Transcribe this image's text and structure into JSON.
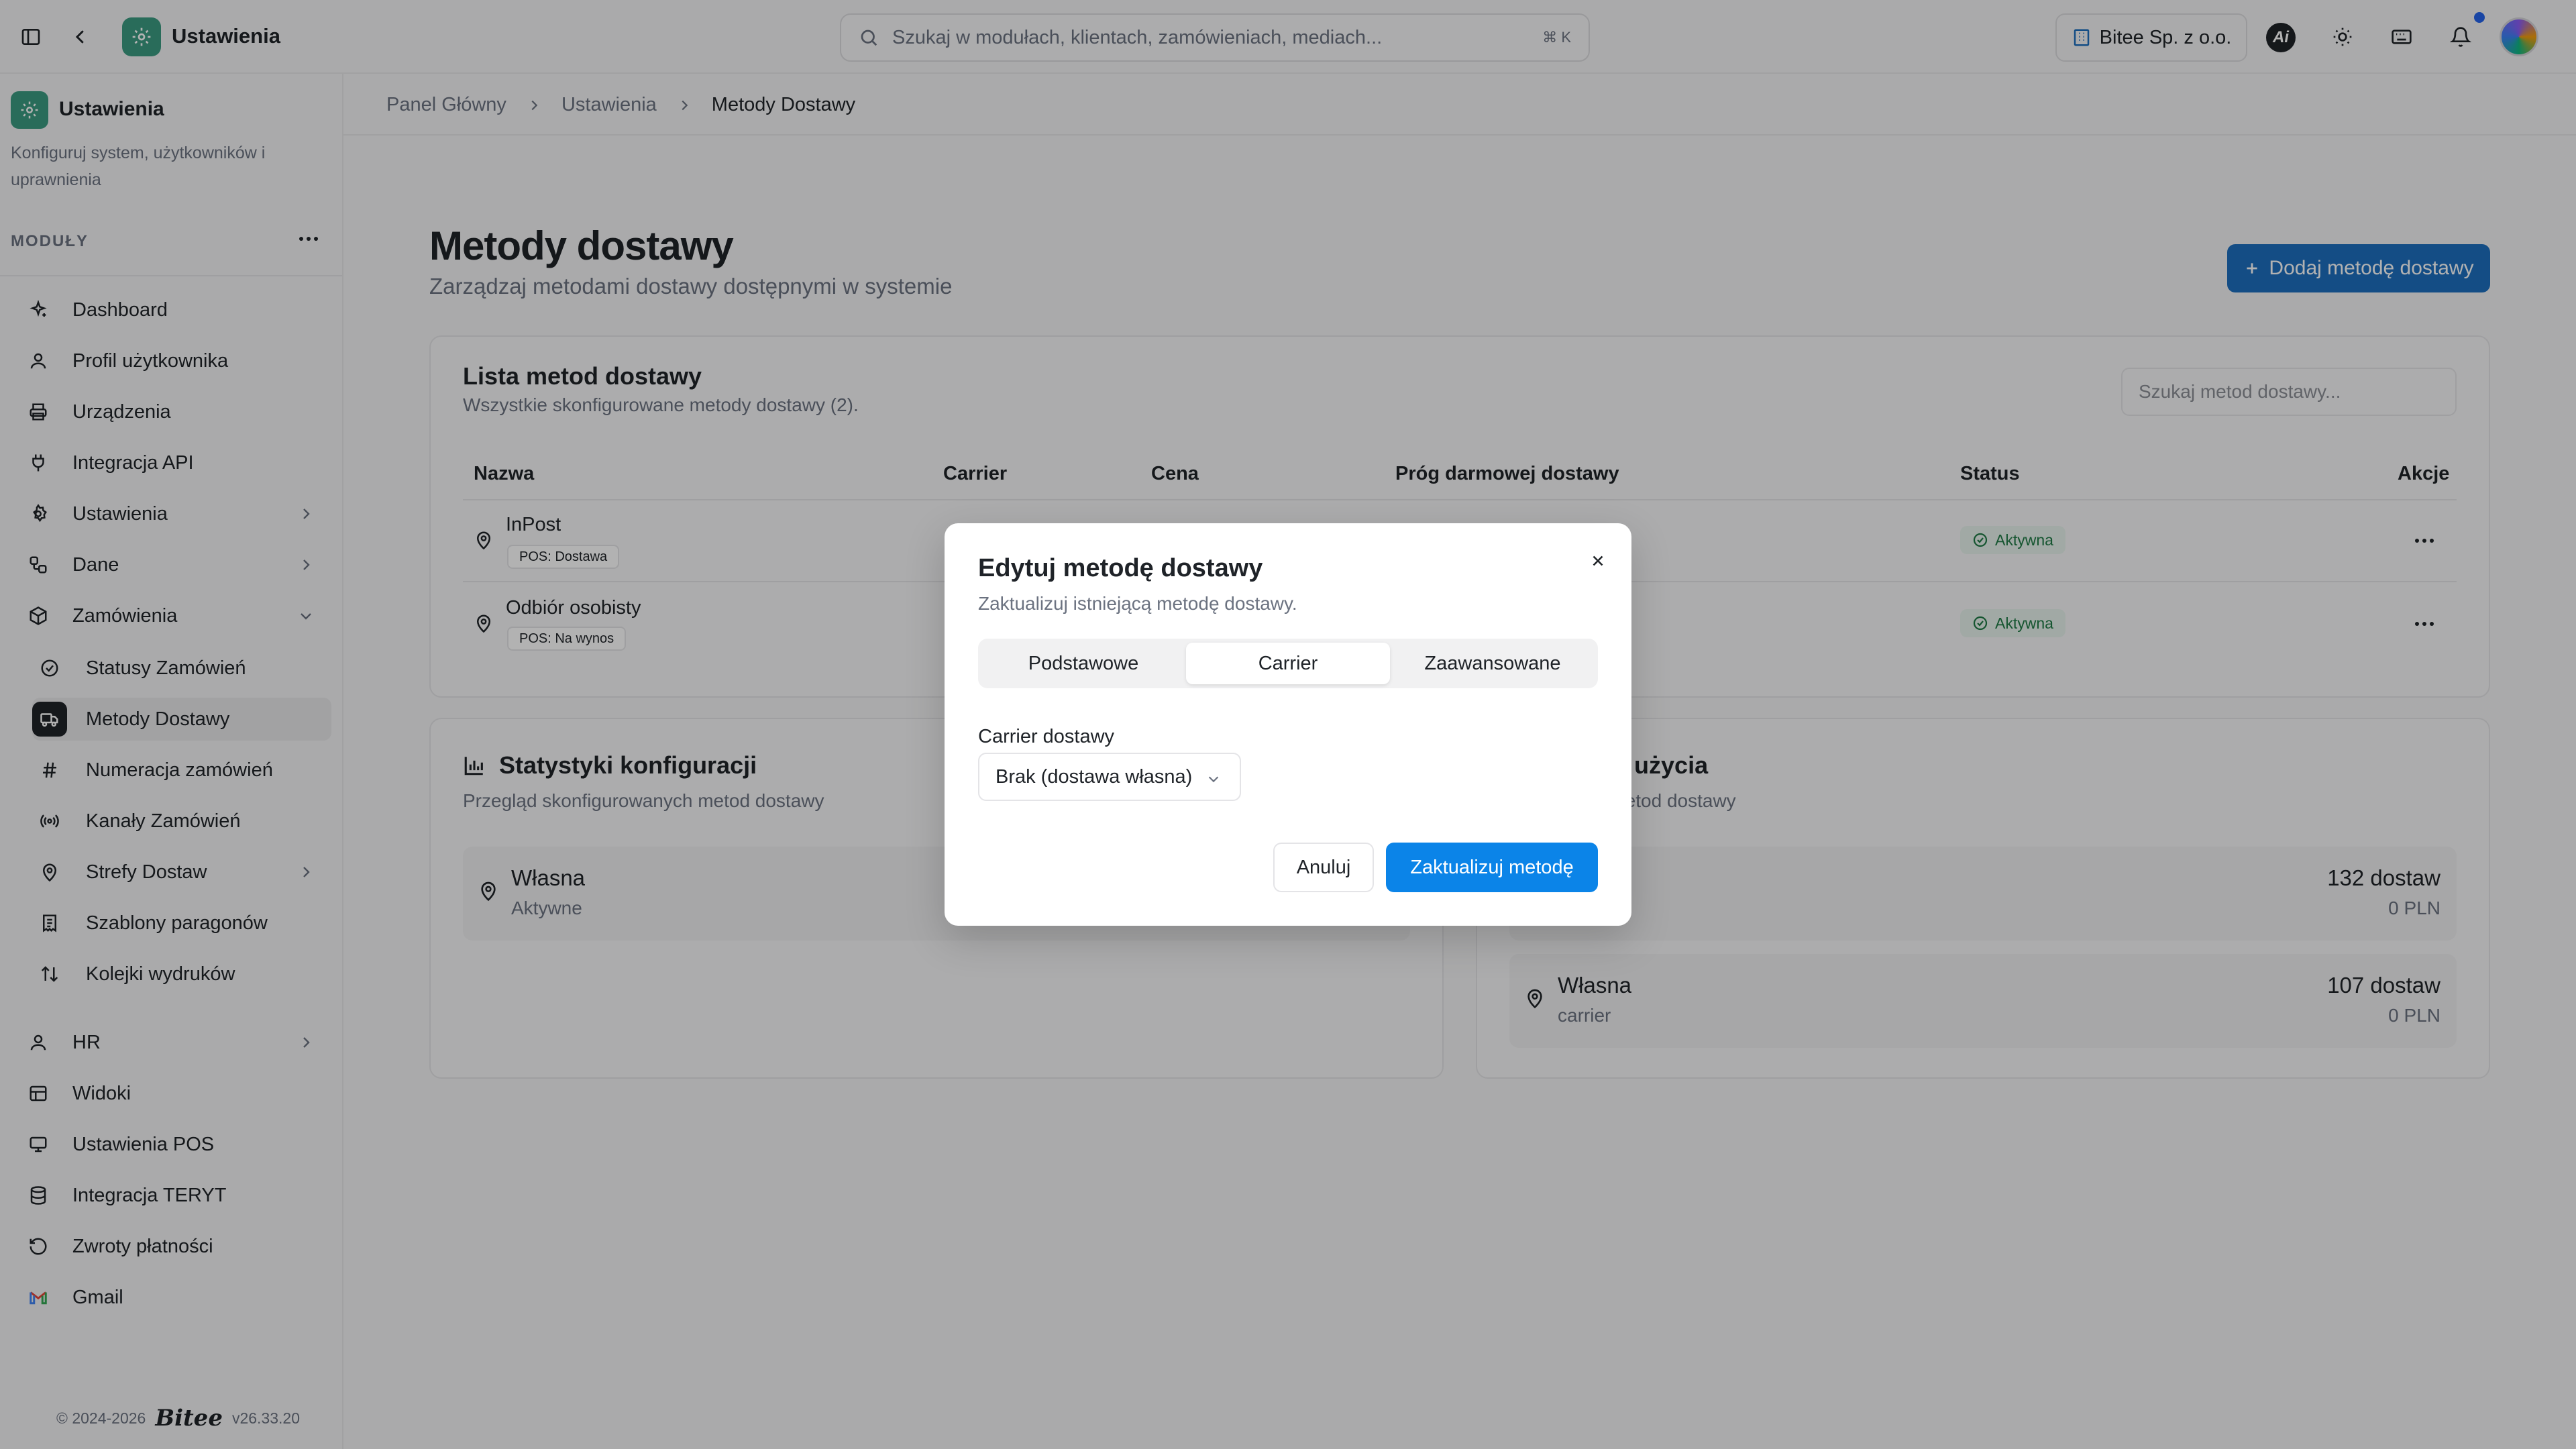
{
  "topbar": {
    "app_title": "Ustawienia",
    "search_placeholder": "Szukaj w modułach, klientach, zamówieniach, mediach...",
    "search_shortcut": "⌘ K",
    "company": "Bitee Sp. z o.o.",
    "ai_label": "Ai"
  },
  "sidebar": {
    "title": "Ustawienia",
    "description": "Konfiguruj system, użytkowników i uprawnienia",
    "modules_label": "MODUŁY",
    "items": [
      {
        "label": "Dashboard",
        "icon": "sparkles-icon"
      },
      {
        "label": "Profil użytkownika",
        "icon": "user-icon"
      },
      {
        "label": "Urządzenia",
        "icon": "printer-icon"
      },
      {
        "label": "Integracja API",
        "icon": "plug-icon"
      },
      {
        "label": "Ustawienia",
        "icon": "gear-icon"
      },
      {
        "label": "Dane",
        "icon": "data-icon"
      },
      {
        "label": "Zamówienia",
        "icon": "package-icon"
      }
    ],
    "sub_items": [
      {
        "label": "Statusy Zamówień",
        "icon": "circle-check-icon"
      },
      {
        "label": "Metody Dostawy",
        "icon": "truck-icon"
      },
      {
        "label": "Numeracja zamówień",
        "icon": "hash-icon"
      },
      {
        "label": "Kanały Zamówień",
        "icon": "radio-icon"
      },
      {
        "label": "Strefy Dostaw",
        "icon": "map-pin-icon"
      },
      {
        "label": "Szablony paragonów",
        "icon": "receipt-icon"
      },
      {
        "label": "Kolejki wydruków",
        "icon": "sort-icon"
      }
    ],
    "bottom_items": [
      {
        "label": "HR",
        "icon": "user-icon"
      },
      {
        "label": "Widoki",
        "icon": "table-icon"
      },
      {
        "label": "Ustawienia POS",
        "icon": "monitor-icon"
      },
      {
        "label": "Integracja TERYT",
        "icon": "database-icon"
      },
      {
        "label": "Zwroty płatności",
        "icon": "rotate-icon"
      },
      {
        "label": "Gmail",
        "icon": "gmail-icon"
      }
    ],
    "footer": {
      "copyright": "© 2024-2026",
      "brand": "Bitee",
      "version": "v26.33.20"
    }
  },
  "breadcrumb": [
    "Panel Główny",
    "Ustawienia",
    "Metody Dostawy"
  ],
  "page": {
    "title": "Metody dostawy",
    "subtitle": "Zarządzaj metodami dostawy dostępnymi w systemie",
    "add_button": "Dodaj metodę dostawy"
  },
  "list": {
    "title": "Lista metod dostawy",
    "subtitle": "Wszystkie skonfigurowane metody dostawy (2).",
    "search_placeholder": "Szukaj metod dostawy...",
    "columns": [
      "Nazwa",
      "Carrier",
      "Cena",
      "Próg darmowej dostawy",
      "Status",
      "Akcje"
    ],
    "rows": [
      {
        "name": "InPost",
        "badge": "POS: Dostawa",
        "status": "Aktywna"
      },
      {
        "name": "Odbiór osobisty",
        "badge": "POS: Na wynos",
        "status": "Aktywna"
      }
    ]
  },
  "stats": {
    "title": "Statystyki konfiguracji",
    "subtitle": "Przegląd skonfigurowanych metod dostawy",
    "tiles": [
      {
        "name": "Własna",
        "sub": "Aktywne"
      }
    ]
  },
  "usage": {
    "title": "yki użycia",
    "subtitle": "e metod dostawy",
    "tiles": [
      {
        "name": "",
        "sub": "",
        "value": "132 dostaw",
        "value2": "0 PLN"
      },
      {
        "name": "Własna",
        "sub": "carrier",
        "value": "107 dostaw",
        "value2": "0 PLN"
      }
    ]
  },
  "modal": {
    "title": "Edytuj metodę dostawy",
    "subtitle": "Zaktualizuj istniejącą metodę dostawy.",
    "tabs": [
      "Podstawowe",
      "Carrier",
      "Zaawansowane"
    ],
    "active_tab": "Carrier",
    "carrier_label": "Carrier dostawy",
    "carrier_value": "Brak (dostawa własna)",
    "cancel": "Anuluj",
    "submit": "Zaktualizuj metodę"
  },
  "colors": {
    "accent": "#0b84e8",
    "brand": "#3b9b82",
    "primary_button": "#1d6fbf",
    "status_active": "#1f7a45"
  }
}
